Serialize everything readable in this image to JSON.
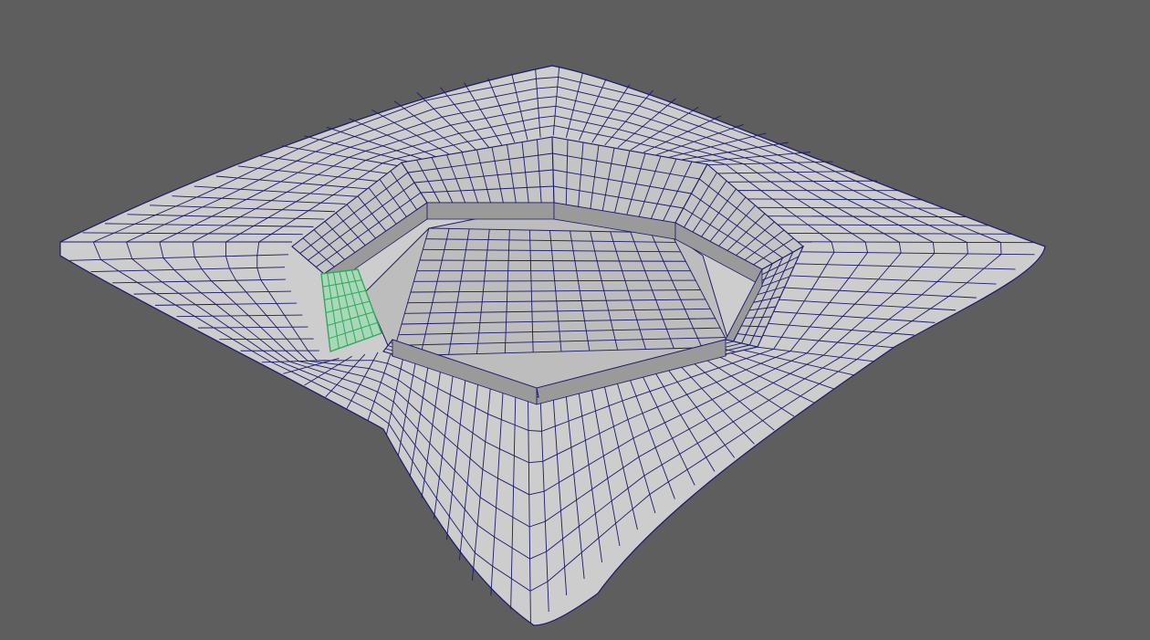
{
  "viewport": {
    "background_color": "#5e5e5e",
    "mesh_fill_color": "#cdcdcd",
    "mesh_inner_fill_color": "#bdbdbd",
    "mesh_shadow_color": "#9a9a9a",
    "wireframe_color": "#1a1a6e",
    "selection_color": "#2faa5a",
    "selection_fill_color": "#a8d8b8"
  },
  "scene": {
    "object": "sunken-seating-pit-mesh",
    "selected_faces": "bench-end-faces"
  }
}
